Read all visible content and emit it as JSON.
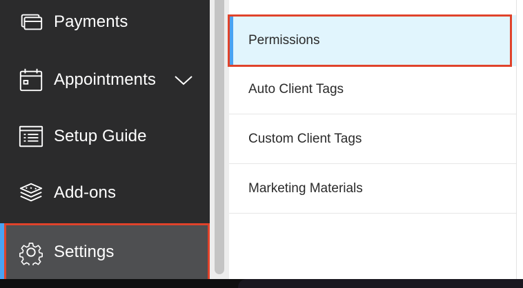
{
  "sidebar": {
    "items": [
      {
        "label": "Payments",
        "icon": "credit-card-icon"
      },
      {
        "label": "Appointments",
        "icon": "calendar-icon",
        "has_chevron": true
      },
      {
        "label": "Setup Guide",
        "icon": "checklist-icon"
      },
      {
        "label": "Add-ons",
        "icon": "layers-icon"
      },
      {
        "label": "Settings",
        "icon": "gear-icon",
        "selected": true
      }
    ]
  },
  "settings_menu": {
    "items": [
      {
        "label": "Permissions",
        "selected": true
      },
      {
        "label": "Auto Client Tags"
      },
      {
        "label": "Custom Client Tags"
      },
      {
        "label": "Marketing Materials"
      }
    ]
  },
  "colors": {
    "sidebar_bg": "#2b2b2c",
    "selected_bg": "#4e4f51",
    "accent_blue": "#4aa3f2",
    "highlight_red": "#e0432b",
    "menu_selected_bg": "#e1f5fd"
  }
}
